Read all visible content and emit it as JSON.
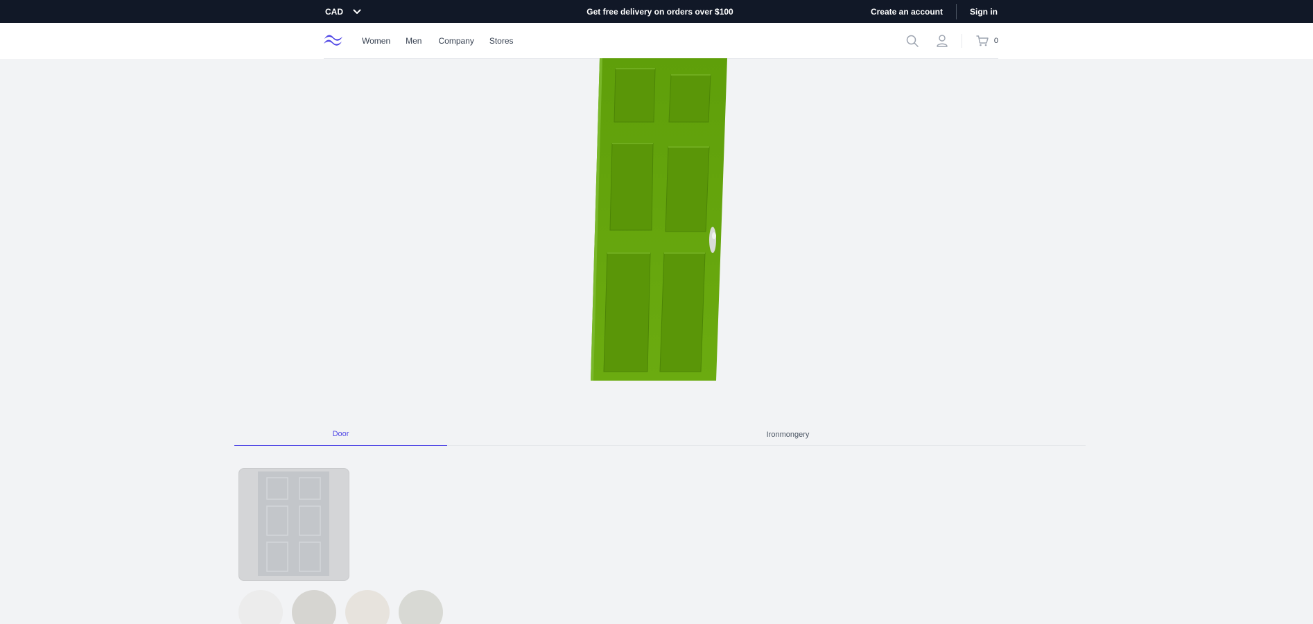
{
  "topbar": {
    "currency": "CAD",
    "announcement": "Get free delivery on orders over $100",
    "create_account": "Create an account",
    "sign_in": "Sign in"
  },
  "header": {
    "logo_icon": "waves-logo-icon",
    "nav": [
      "Women",
      "Men",
      "Company",
      "Stores"
    ],
    "icons": [
      "search-icon",
      "user-icon",
      "cart-icon"
    ],
    "cart_count": "0"
  },
  "viewer": {
    "door_color": "#64a30d",
    "handle_icon": "door-handle-icon"
  },
  "tabs": {
    "items": [
      "Door",
      "Ironmongery"
    ],
    "active": "Door"
  },
  "options": {
    "thumbnail_icon": "door-thumbnail-icon",
    "swatches": [
      "#ececec",
      "#d6d5d1",
      "#e7e3dd",
      "#d8d9d4"
    ]
  },
  "colors": {
    "topbar_bg": "#111827",
    "accent": "#4f46e5",
    "page_bg": "#f2f3f5"
  }
}
